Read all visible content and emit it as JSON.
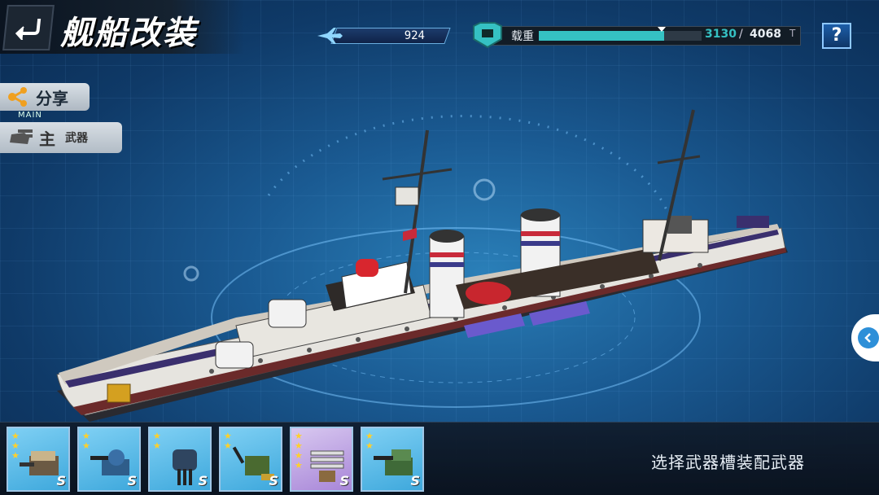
{
  "header": {
    "title": "舰船改装",
    "back_icon": "back-arrow-icon"
  },
  "resources": {
    "fuel_value": "924",
    "fuel_icon": "plane-icon",
    "load_label": "载重",
    "load_current": "3130",
    "load_separator": "/",
    "load_max": "4068",
    "load_unit": "T",
    "load_fraction": 0.769
  },
  "help": {
    "label": "?"
  },
  "side_panel": {
    "share_label": "分享",
    "main_tag": "MAIN",
    "weapon_main": "主",
    "weapon_sub": "武器"
  },
  "weapon_cards": [
    {
      "stars": 3,
      "grade": "S",
      "frame": "blue",
      "icon": "turret-icon"
    },
    {
      "stars": 2,
      "grade": "S",
      "frame": "blue",
      "icon": "gun-mount-icon"
    },
    {
      "stars": 2,
      "grade": "S",
      "frame": "blue",
      "icon": "triple-turret-icon"
    },
    {
      "stars": 2,
      "grade": "S",
      "frame": "blue",
      "icon": "aa-gun-icon"
    },
    {
      "stars": 4,
      "grade": "S",
      "frame": "purple",
      "icon": "torpedo-launcher-icon"
    },
    {
      "stars": 2,
      "grade": "S",
      "frame": "blue",
      "icon": "green-turret-icon"
    }
  ],
  "hint_text": "选择武器槽装配武器",
  "colors": {
    "accent": "#35c1c3",
    "star": "#ffd02a",
    "card_blue": "#3ea8dc",
    "card_purple": "#a886d8"
  }
}
